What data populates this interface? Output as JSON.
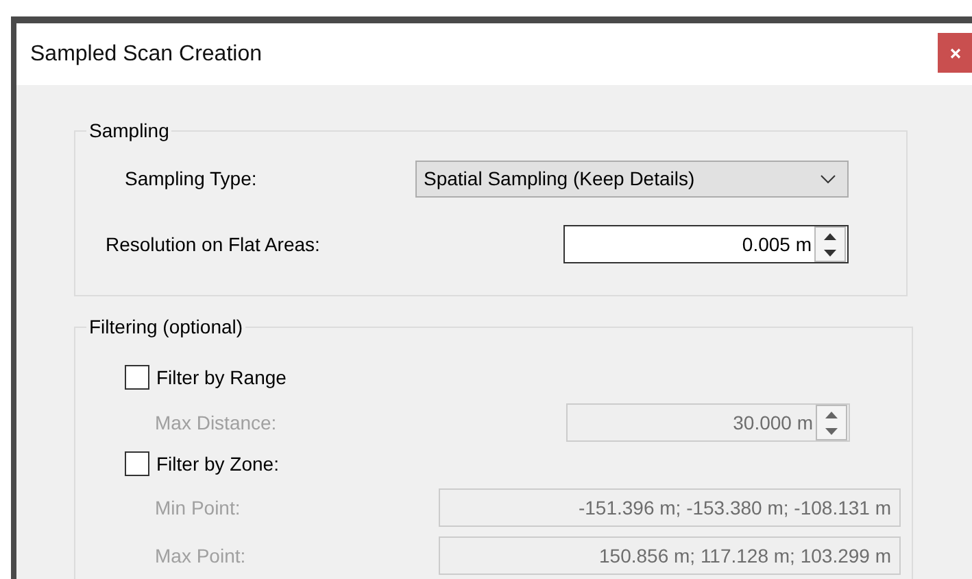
{
  "window": {
    "title": "Sampled Scan Creation"
  },
  "sampling": {
    "legend": "Sampling",
    "sampling_type": {
      "label": "Sampling Type:",
      "value": "Spatial Sampling (Keep Details)"
    },
    "resolution": {
      "label": "Resolution on Flat Areas:",
      "value": "0.005 m",
      "disabled": false
    }
  },
  "filtering": {
    "legend": "Filtering (optional)",
    "filters": [
      {
        "label": "Filter by Range",
        "checked": false,
        "fields": [
          {
            "kind": "spinner",
            "label": "Max Distance:",
            "value": "30.000 m",
            "disabled": true
          }
        ]
      },
      {
        "label": "Filter by Zone:",
        "checked": false,
        "fields": [
          {
            "kind": "text",
            "label": "Min Point:",
            "value": "-151.396 m; -153.380 m; -108.131 m",
            "disabled": true
          },
          {
            "kind": "text",
            "label": "Max Point:",
            "value": "150.856 m; 117.128 m; 103.299 m",
            "disabled": true
          }
        ]
      }
    ]
  }
}
